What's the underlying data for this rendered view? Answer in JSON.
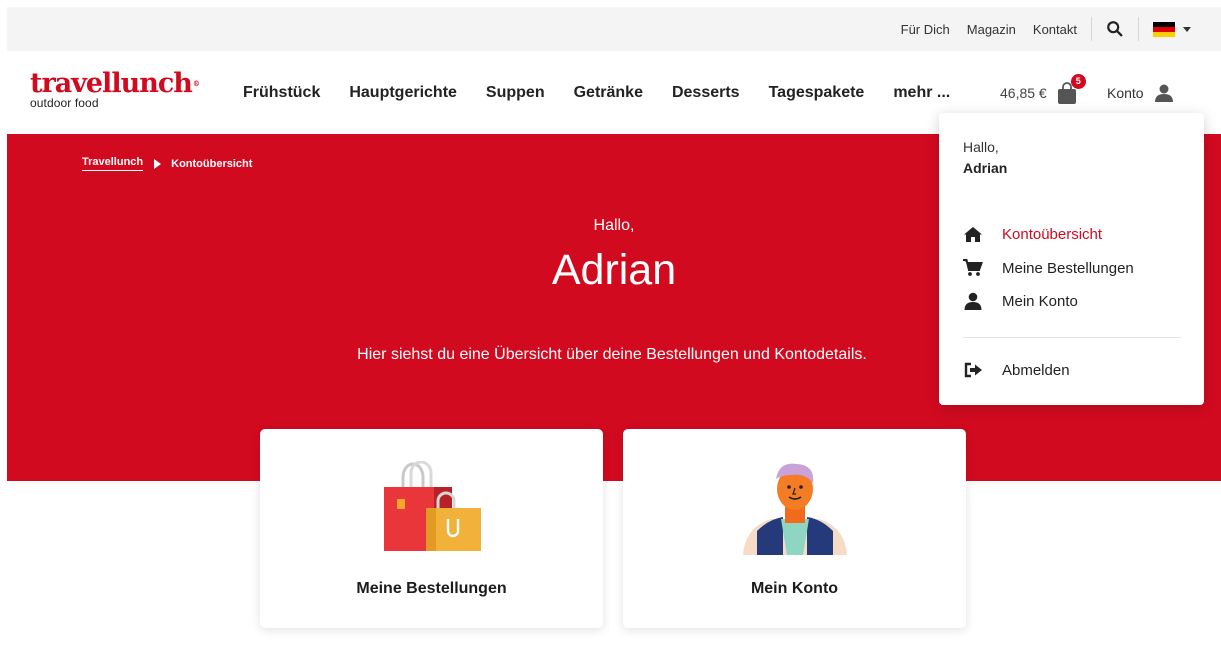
{
  "topbar": {
    "links": [
      "Für Dich",
      "Magazin",
      "Kontakt"
    ],
    "language_icon": "german-flag-icon"
  },
  "header": {
    "logo_brand": "travellunch",
    "logo_sub": "outdoor food",
    "nav": [
      "Frühstück",
      "Hauptgerichte",
      "Suppen",
      "Getränke",
      "Desserts",
      "Tagespakete",
      "mehr ..."
    ],
    "cart_total": "46,85 €",
    "cart_count": "5",
    "account_label": "Konto"
  },
  "breadcrumb": {
    "home": "Travellunch",
    "current": "Kontoübersicht"
  },
  "hero": {
    "greeting": "Hallo,",
    "name": "Adrian",
    "description": "Hier siehst du eine Übersicht über deine Bestellungen und Kontodetails."
  },
  "cards": {
    "orders": "Meine Bestellungen",
    "account": "Mein Konto"
  },
  "dropdown": {
    "greeting": "Hallo,",
    "name": "Adrian",
    "items": [
      {
        "label": "Kontoübersicht",
        "icon": "home-icon"
      },
      {
        "label": "Meine Bestellungen",
        "icon": "cart-icon"
      },
      {
        "label": "Mein Konto",
        "icon": "user-icon"
      }
    ],
    "logout": "Abmelden"
  },
  "colors": {
    "brand_red": "#d20a20",
    "topbar_bg": "#f4f4f4"
  }
}
